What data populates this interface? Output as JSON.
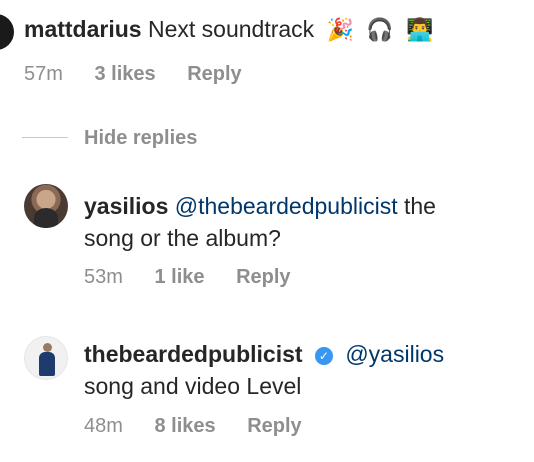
{
  "comment_top": {
    "username": "mattdarius",
    "text": "Next soundtrack",
    "emojis": [
      "party-emoji",
      "headphones-icon",
      "person-laptop-emoji"
    ],
    "time": "57m",
    "likes": "3 likes",
    "reply": "Reply"
  },
  "thread": {
    "hide_replies": "Hide replies"
  },
  "reply_1": {
    "username": "yasilios",
    "mention": "@thebeardedpublicist",
    "text_line1_suffix": "the",
    "text_line2": "song or the album?",
    "time": "53m",
    "likes": "1 like",
    "reply": "Reply"
  },
  "reply_2": {
    "username": "thebeardedpublicist",
    "verified": true,
    "mention": "@yasilios",
    "text_line2": "song and video Level",
    "time": "48m",
    "likes": "8 likes",
    "reply": "Reply"
  },
  "colors": {
    "text": "#262626",
    "muted": "#8e8e8e",
    "mention": "#00376b",
    "verified": "#3897f0"
  }
}
